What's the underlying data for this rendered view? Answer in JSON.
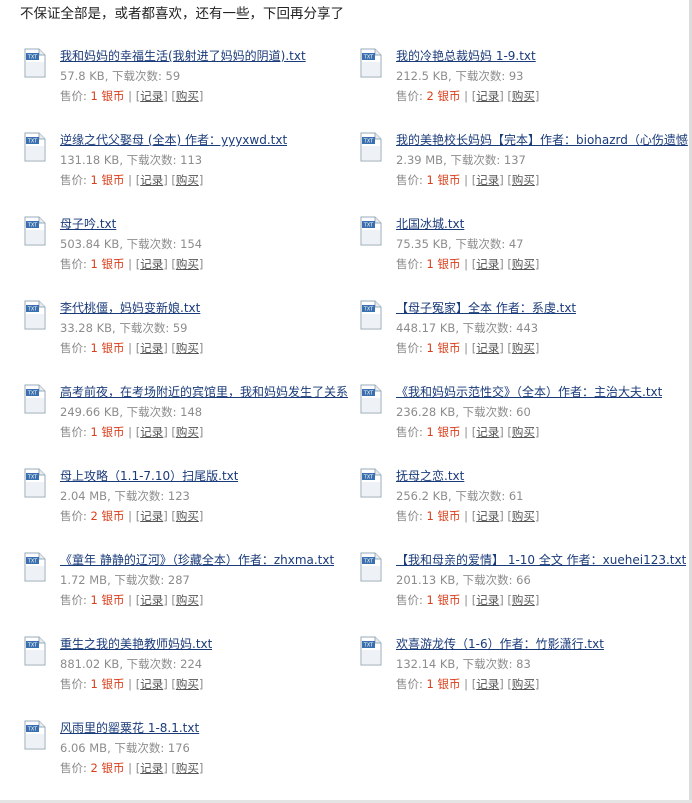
{
  "intro": "不保证全部是，或者都喜欢，还有一些，下回再分享了",
  "labels": {
    "downloads": "下载次数:",
    "price": "售价:",
    "currency": "银币",
    "record": "记录",
    "buy": "购买",
    "bracket_open": "[",
    "bracket_close": "]",
    "separator": "|"
  },
  "icon_text": "TXT",
  "attachments": [
    {
      "name": "我和妈妈的幸福生活(我射进了妈妈的阴道).txt",
      "size": "57.8 KB",
      "downloads": "59",
      "price": "1"
    },
    {
      "name": "我的冷艳总裁妈妈 1-9.txt",
      "size": "212.5 KB",
      "downloads": "93",
      "price": "2"
    },
    {
      "name": "逆缘之代父娶母 (全本) 作者：yyyxwd.txt",
      "size": "131.18 KB",
      "downloads": "113",
      "price": "1"
    },
    {
      "name": "我的美艳校长妈妈【完本】作者：biohazrd（心伤遗憾",
      "size": "2.39 MB",
      "downloads": "137",
      "price": "1"
    },
    {
      "name": "母子吟.txt",
      "size": "503.84 KB",
      "downloads": "154",
      "price": "1"
    },
    {
      "name": "北国冰城.txt",
      "size": "75.35 KB",
      "downloads": "47",
      "price": "1"
    },
    {
      "name": "李代桃僵，妈妈变新娘.txt",
      "size": "33.28 KB",
      "downloads": "59",
      "price": "1"
    },
    {
      "name": "【母子冤家】全本 作者：系虔.txt",
      "size": "448.17 KB",
      "downloads": "443",
      "price": "1"
    },
    {
      "name": "高考前夜，在考场附近的宾馆里，我和妈妈发生了关系",
      "size": "249.66 KB",
      "downloads": "148",
      "price": "1"
    },
    {
      "name": "《我和妈妈示范性交》（全本）作者：主治大夫.txt",
      "size": "236.28 KB",
      "downloads": "60",
      "price": "1"
    },
    {
      "name": "母上攻略（1.1-7.10）扫尾版.txt",
      "size": "2.04 MB",
      "downloads": "123",
      "price": "2"
    },
    {
      "name": "抚母之恋.txt",
      "size": "256.2 KB",
      "downloads": "61",
      "price": "1"
    },
    {
      "name": "《童年 静静的辽河》（珍藏全本）作者：zhxma.txt",
      "size": "1.72 MB",
      "downloads": "287",
      "price": "1"
    },
    {
      "name": "【我和母亲的爱情】 1-10 全文 作者：xuehei123.txt",
      "size": "201.13 KB",
      "downloads": "66",
      "price": "1"
    },
    {
      "name": "重生之我的美艳教师妈妈.txt",
      "size": "881.02 KB",
      "downloads": "224",
      "price": "1"
    },
    {
      "name": "欢喜游龙传（1-6）作者：竹影潇行.txt",
      "size": "132.14 KB",
      "downloads": "83",
      "price": "1"
    },
    {
      "name": "风雨里的罂粟花 1-8.1.txt",
      "size": "6.06 MB",
      "downloads": "176",
      "price": "2"
    }
  ]
}
